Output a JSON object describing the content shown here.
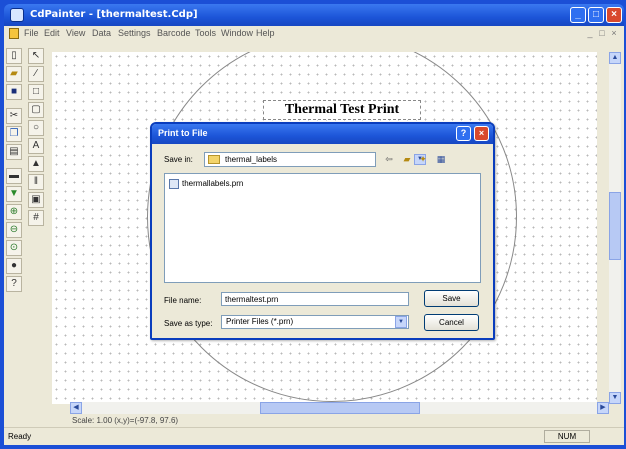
{
  "window": {
    "title": "CdPainter - [thermaltest.Cdp]",
    "minimize_glyph": "_",
    "maximize_glyph": "□",
    "close_glyph": "×"
  },
  "menubar": {
    "items": [
      "File",
      "Edit",
      "View",
      "Data",
      "Settings",
      "Barcode",
      "Tools",
      "Window",
      "Help"
    ]
  },
  "document": {
    "title_text": "Thermal Test Print"
  },
  "status": {
    "scale": "Scale: 1.00    (x,y)=(-97.8, 97.6)",
    "ready": "Ready",
    "num": "NUM"
  },
  "dialog": {
    "title": "Print to File",
    "help_glyph": "?",
    "close_glyph": "×",
    "save_in_label": "Save in:",
    "save_in_value": "thermal_labels",
    "files": [
      "thermallabels.prn"
    ],
    "file_name_label": "File name:",
    "file_name_value": "thermaltest.prn",
    "save_as_type_label": "Save as type:",
    "save_as_type_value": "Printer Files (*.prn)",
    "save_button": "Save",
    "cancel_button": "Cancel"
  },
  "colors": {
    "xp_blue": "#1c55d8",
    "close_red": "#d9492d",
    "face": "#ece9d8"
  }
}
